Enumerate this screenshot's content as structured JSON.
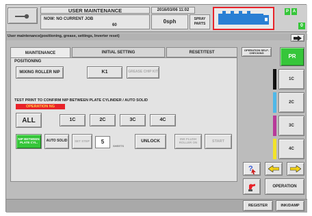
{
  "header": {
    "title": "USER MAINTENANCE",
    "datetime": "2016/03/06 11:02",
    "job_label": "NOW: NO CURRENT JOB",
    "job_number": "60",
    "speed": "0sph",
    "spray_label": "SPRAY PARTS",
    "indicator_p": "P",
    "indicator_a": "A",
    "counter": "0"
  },
  "breadcrumb": "User maintenance(positioning, grease, settings, Inverter reset)",
  "tabs": [
    {
      "label": "MAINTENANCE"
    },
    {
      "label": "INITIAL SETTING"
    },
    {
      "label": "RESET/TEST"
    }
  ],
  "positioning": {
    "title": "POSITIONING",
    "mixing_roller_nip": "MIXING ROLLER NIP",
    "k1": "K1",
    "grease_label": "GREASE CHIP KIT"
  },
  "test_print": {
    "heading": "TEST PRINT TO CONFIRM NIP BETWEEN PLATE CYLINDER / AUTO SOLID",
    "status": "OPERATION NG",
    "all": "ALL",
    "units": [
      "1C",
      "2C",
      "3C",
      "4C"
    ]
  },
  "bottom_controls": {
    "nip_btn": "NIP BETWEEN PLATE CYL.",
    "auto_solid": "AUTO SOLID",
    "set_disabled": "SET STEP",
    "count_value": "5",
    "count_unit": "SHEETS",
    "unlock": "UNLOCK",
    "roller_on": "INK FLUSH ROLLER ON",
    "start": "START"
  },
  "sidebar": {
    "operation_label": "OPERATION SELF-CHECKING",
    "pr": "PR",
    "units": [
      "1C",
      "2C",
      "3C",
      "4C"
    ],
    "unit_colors": [
      "#111111",
      "#4fb8e8",
      "#b83a9a",
      "#f2e32a"
    ],
    "help_icon": "question-icon",
    "back_icon": "arrow-left-icon",
    "forward_icon": "arrow-right-icon",
    "operation": "OPERATION",
    "register": "REGISTER",
    "inkdamp": "INK/DAMP"
  }
}
